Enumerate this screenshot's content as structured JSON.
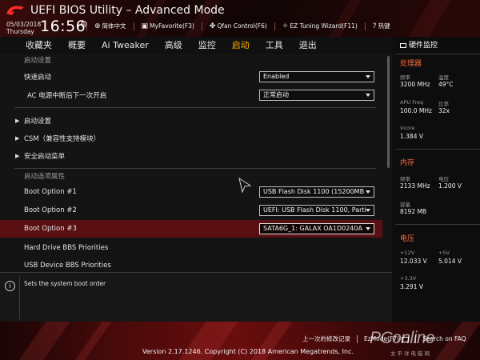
{
  "header": {
    "title": "UEFI BIOS Utility – Advanced Mode",
    "date": "05/03/2018",
    "weekday": "Thursday",
    "time": "16:56",
    "tools": [
      {
        "label": "简体中文",
        "icon": "globe-icon"
      },
      {
        "label": "MyFavorite(F3)",
        "icon": "favorite-icon"
      },
      {
        "label": "Qfan Control(F6)",
        "icon": "fan-icon"
      },
      {
        "label": "EZ Tuning Wizard(F11)",
        "icon": "wizard-icon"
      },
      {
        "label": "热键",
        "icon": "hotkey-icon"
      }
    ]
  },
  "menu": {
    "items": [
      "收藏夹",
      "概要",
      "Ai Tweaker",
      "高级",
      "监控",
      "启动",
      "工具",
      "退出"
    ],
    "active_index": 5
  },
  "main": {
    "section_boot_settings": "启动设置",
    "fast_boot_label": "快速启动",
    "fast_boot_value": "Enabled",
    "ac_power_label": "AC 电源中断后下一次开启",
    "ac_power_value": "正常启动",
    "boot_settings_sub": "启动设置",
    "csm_label": "CSM（兼容性支持模块）",
    "secure_boot_label": "安全启动菜单",
    "section_boot_priority": "启动选项属性",
    "boot_options": [
      {
        "label": "Boot Option #1",
        "value": "USB Flash Disk 1100  (15200MB"
      },
      {
        "label": "Boot Option #2",
        "value": "UEFI: USB Flash Disk 1100, Parti"
      },
      {
        "label": "Boot Option #3",
        "value": "SATA6G_1: GALAX OA1D0240A"
      }
    ],
    "hdd_bbs_label": "Hard Drive BBS Priorities",
    "usb_bbs_label": "USB Device BBS Priorities"
  },
  "help": {
    "text": "Sets the system boot order"
  },
  "hw_monitor": {
    "title": "硬件监控",
    "cpu": {
      "title": "处理器",
      "freq_label": "频率",
      "freq_value": "3200 MHz",
      "temp_label": "温度",
      "temp_value": "49°C",
      "apu_label": "APU Freq",
      "apu_value": "100.0 MHz",
      "ratio_label": "比率",
      "ratio_value": "32x",
      "vcore_label": "Vcore",
      "vcore_value": "1.384 V"
    },
    "memory": {
      "title": "内存",
      "freq_label": "频率",
      "freq_value": "2133 MHz",
      "volt_label": "电压",
      "volt_value": "1.200 V",
      "cap_label": "容量",
      "cap_value": "8192 MB"
    },
    "voltage": {
      "title": "电压",
      "v12_label": "+12V",
      "v12_value": "12.033 V",
      "v5_label": "+5V",
      "v5_value": "5.014 V",
      "v33_label": "+3.3V",
      "v33_value": "3.291 V"
    }
  },
  "footer": {
    "last_modified": "上一次的修改记录",
    "ezmode": "EzMode(F7)",
    "search": "Search on FAQ",
    "version": "Version 2.17.1246. Copyright (C) 2018 American Megatrends, Inc.",
    "watermark_main": "PConline",
    "watermark_sub": "太平洋电脑网"
  },
  "colors": {
    "accent": "#ffb400",
    "hw_section": "#ff6a3a",
    "selected_row": "#5a0f12"
  }
}
